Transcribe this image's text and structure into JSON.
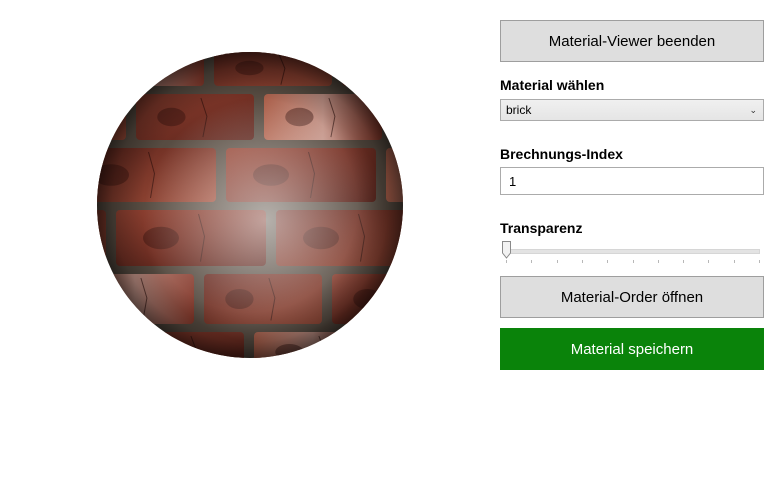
{
  "viewer": {
    "material_name": "brick",
    "colors": {
      "brick_base": "#7e3528",
      "brick_light": "#c27a64",
      "mortar": "#5e5247",
      "highlight": "#e8e0dc"
    }
  },
  "panel": {
    "close_button_label": "Material-Viewer beenden",
    "material_label": "Material wählen",
    "material_selected": "brick",
    "refraction_label": "Brechnungs-Index",
    "refraction_value": "1",
    "transparency_label": "Transparenz",
    "transparency_value": 0,
    "transparency_min": 0,
    "transparency_max": 1,
    "transparency_ticks": 11,
    "open_folder_label": "Material-Order öffnen",
    "save_label": "Material speichern",
    "colors": {
      "button_gray": "#dedede",
      "save_green": "#0a830a"
    }
  }
}
